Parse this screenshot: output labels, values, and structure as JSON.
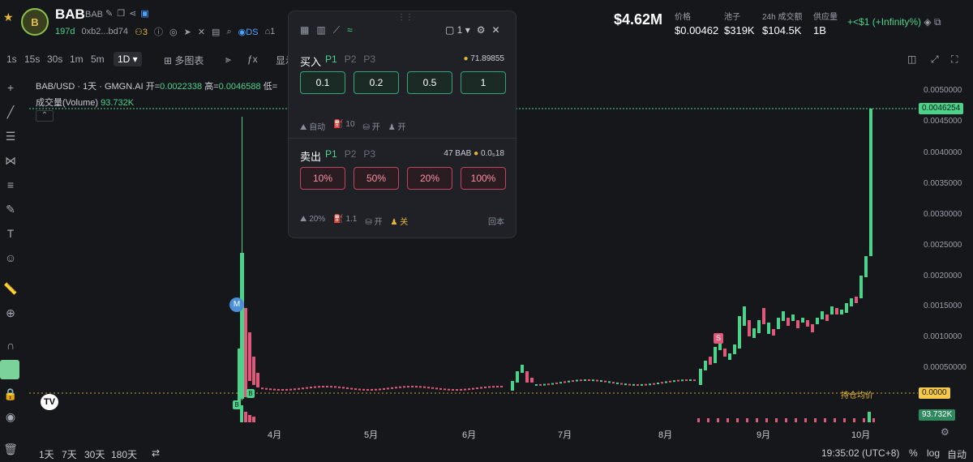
{
  "header": {
    "name": "BAB",
    "symbol": "BAB",
    "age": "197d",
    "address": "0xb2...bd74",
    "holders": "3",
    "ds_label": "DS",
    "fav_count": "1",
    "market_cap": "$4.62M",
    "stats": [
      {
        "label": "价格",
        "value": "$0.00462"
      },
      {
        "label": "池子",
        "value": "$319K"
      },
      {
        "label": "24h 成交额",
        "value": "$104.5K"
      },
      {
        "label": "供应量",
        "value": "1B"
      }
    ],
    "change": "+<$1 (+Infinity%)"
  },
  "toolbar": {
    "timeframes": [
      "1s",
      "15s",
      "30s",
      "1m",
      "5m"
    ],
    "selected_tf": "1D",
    "multi_chart": "多图表",
    "display": "显示"
  },
  "chart": {
    "pair_label": "BAB/USD · 1天 · GMGN.AI",
    "open_label": "开=",
    "open": "0.0022338",
    "high_label": "高=",
    "high": "0.0046588",
    "low_label": "低=",
    "volume_label": "成交量(Volume)",
    "volume": "93.732K",
    "price_ticks": [
      "0.0050000",
      "0.0045000",
      "0.0040000",
      "0.0035000",
      "0.0030000",
      "0.0025000",
      "0.0020000",
      "0.0015000",
      "0.0010000",
      "0.00050000",
      "0.0000"
    ],
    "current_price_tag": "0.0046254",
    "avg_label": "持仓均价",
    "avg_tag": "0.0000",
    "volume_tag": "93.732K",
    "date_labels": [
      "4月",
      "5月",
      "6月",
      "7月",
      "8月",
      "9月",
      "10月"
    ],
    "markers": {
      "m": "M",
      "s": "S",
      "b": "B"
    }
  },
  "popup": {
    "count": "1",
    "buy_label": "买入",
    "presets": [
      "P1",
      "P2",
      "P3"
    ],
    "balance": "71.89855",
    "buy_amounts": [
      "0.1",
      "0.2",
      "0.5",
      "1"
    ],
    "buy_auto": "自动",
    "buy_gas": "10",
    "buy_anti": "开",
    "buy_mev": "开",
    "sell_label": "卖出",
    "sell_holding": "47 BAB",
    "sell_value": "0.0₅18",
    "sell_amounts": [
      "10%",
      "50%",
      "20%",
      "100%"
    ],
    "sell_slip": "20%",
    "sell_gas": "1.1",
    "sell_anti": "开",
    "sell_mev": "关",
    "cost_back": "回本"
  },
  "bottom": {
    "ranges": [
      "1天",
      "7天",
      "30天",
      "180天"
    ],
    "time": "19:35:02 (UTC+8)",
    "percent": "%",
    "log": "log",
    "auto": "自动"
  },
  "colors": {
    "up": "#4cd38b",
    "down": "#e0587a",
    "bg": "#16171b"
  }
}
